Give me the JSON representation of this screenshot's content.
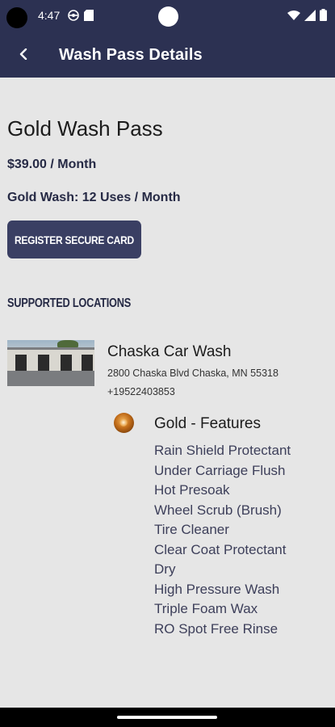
{
  "status_bar": {
    "time": "4:47"
  },
  "app_bar": {
    "title": "Wash Pass Details"
  },
  "pass": {
    "title": "Gold Wash Pass",
    "price": "$39.00 / Month",
    "uses": "Gold Wash: 12 Uses / Month",
    "register_label": "Register Secure Card"
  },
  "locations": {
    "heading": "Supported Locations",
    "items": [
      {
        "name": "Chaska Car Wash",
        "address": "2800 Chaska Blvd Chaska, MN 55318",
        "phone": "+19522403853",
        "features_title": "Gold - Features",
        "features": [
          "Rain Shield Protectant",
          "Under Carriage Flush",
          "Hot Presoak",
          "Wheel Scrub (Brush)",
          "Tire Cleaner",
          "Clear Coat Protectant",
          "Dry",
          "High Pressure Wash",
          "Triple Foam Wax",
          "RO Spot Free Rinse"
        ]
      }
    ]
  },
  "colors": {
    "primary": "#2c3152",
    "button": "#3a3f63",
    "background": "#e6e6e6"
  }
}
